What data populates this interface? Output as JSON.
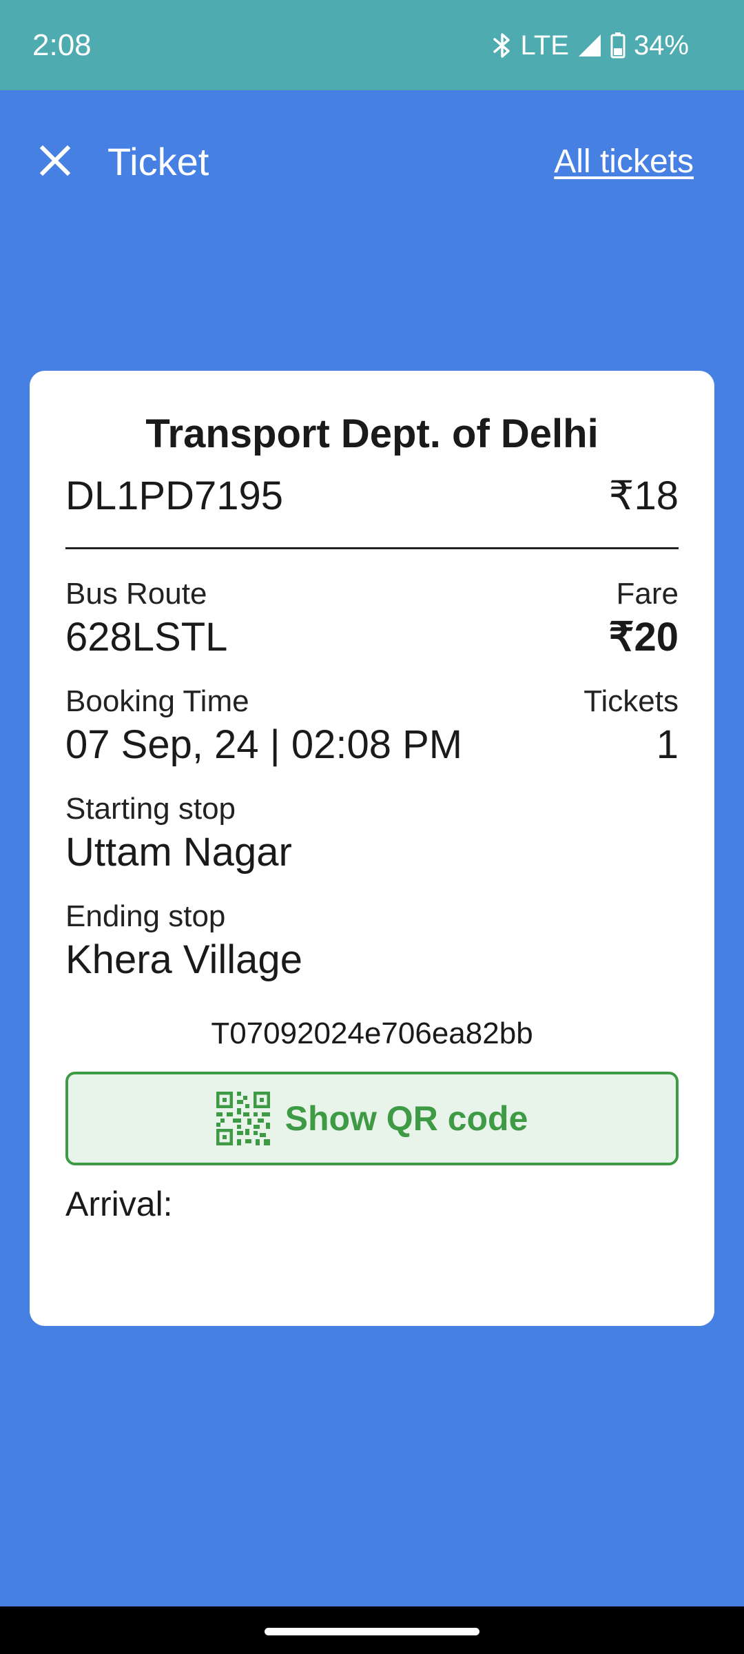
{
  "status_bar": {
    "time": "2:08",
    "network": "LTE",
    "battery": "34%",
    "icons": [
      "bluetooth-icon",
      "signal-icon",
      "battery-icon"
    ]
  },
  "app_bar": {
    "close_icon": "close-icon",
    "title": "Ticket",
    "all_tickets_label": "All tickets"
  },
  "ticket": {
    "agency": "Transport Dept. of Delhi",
    "vehicle_number": "DL1PD7195",
    "vehicle_amount": "₹18",
    "bus_route_label": "Bus Route",
    "bus_route": "628LSTL",
    "fare_label": "Fare",
    "fare": "₹20",
    "booking_time_label": "Booking Time",
    "booking_time": "07 Sep, 24 | 02:08 PM",
    "tickets_label": "Tickets",
    "tickets_count": "1",
    "starting_stop_label": "Starting stop",
    "starting_stop": "Uttam Nagar",
    "ending_stop_label": "Ending stop",
    "ending_stop": "Khera Village",
    "ticket_id": "T07092024e706ea82bb",
    "qr_button_label": "Show QR code",
    "qr_icon": "qr-code-icon",
    "arrival_label": "Arrival:"
  },
  "colors": {
    "background": "#4780e3",
    "status_bar": "#4eabaf",
    "accent_green": "#3f9a45",
    "qr_button_bg": "#e8f3ea"
  }
}
